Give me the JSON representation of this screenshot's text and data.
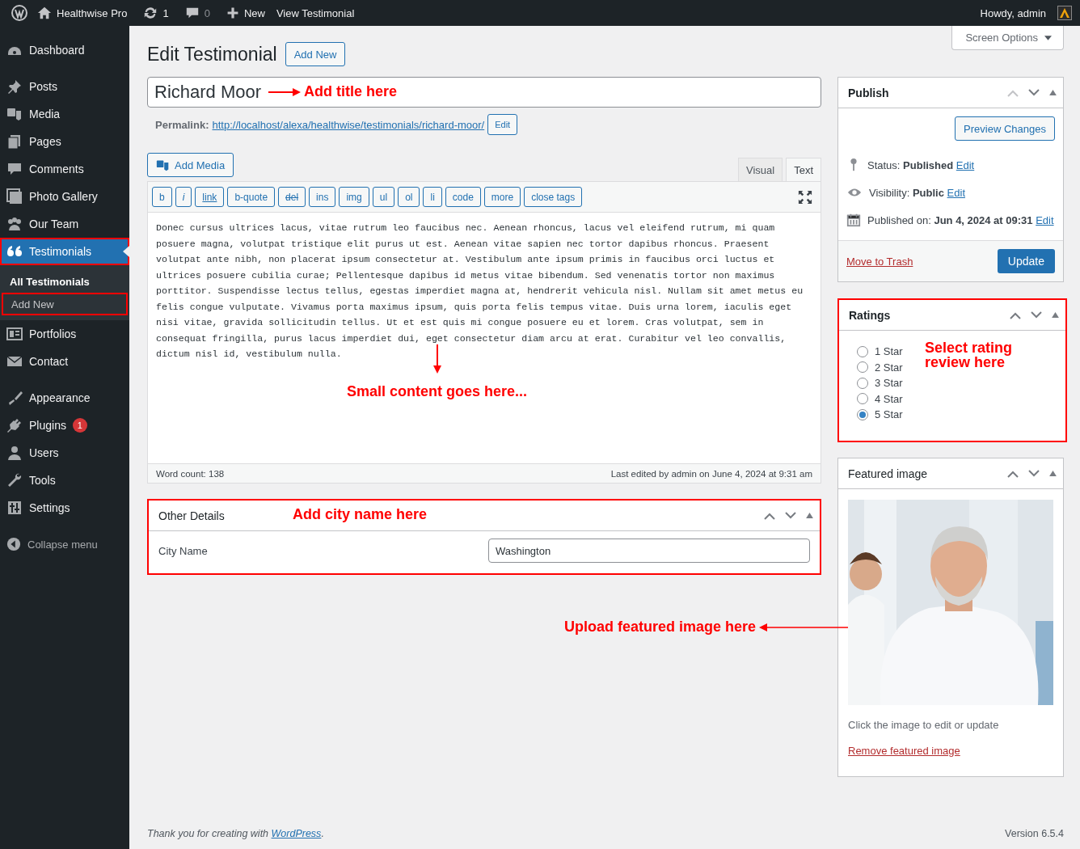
{
  "admin_bar": {
    "site_name": "Healthwise Pro",
    "updates": "1",
    "comments": "0",
    "new_label": "New",
    "view_label": "View Testimonial",
    "greeting": "Howdy, admin"
  },
  "sidebar": {
    "groups": [
      [
        {
          "label": "Dashboard",
          "selected": false,
          "highlighted": false
        }
      ],
      [
        {
          "label": "Posts",
          "selected": false,
          "highlighted": false
        },
        {
          "label": "Media",
          "selected": false,
          "highlighted": false
        },
        {
          "label": "Pages",
          "selected": false,
          "highlighted": false
        },
        {
          "label": "Comments",
          "selected": false,
          "highlighted": false
        },
        {
          "label": "Photo Gallery",
          "selected": false,
          "highlighted": false
        },
        {
          "label": "Our Team",
          "selected": false,
          "highlighted": false
        },
        {
          "label": "Testimonials",
          "selected": true,
          "highlighted": true,
          "children": [
            {
              "label": "All Testimonials",
              "selected": true,
              "highlighted": false
            },
            {
              "label": "Add New",
              "selected": false,
              "highlighted": true
            }
          ]
        },
        {
          "label": "Portfolios",
          "selected": false,
          "highlighted": false
        },
        {
          "label": "Contact",
          "selected": false,
          "highlighted": false
        }
      ],
      [
        {
          "label": "Appearance",
          "selected": false,
          "highlighted": false
        },
        {
          "label": "Plugins",
          "selected": false,
          "highlighted": false,
          "badge": "1"
        },
        {
          "label": "Users",
          "selected": false,
          "highlighted": false
        },
        {
          "label": "Tools",
          "selected": false,
          "highlighted": false
        },
        {
          "label": "Settings",
          "selected": false,
          "highlighted": false
        }
      ]
    ],
    "collapse_label": "Collapse menu"
  },
  "screen_options": "Screen Options",
  "heading": "Edit Testimonial",
  "add_new_button": "Add New",
  "title": {
    "value": "Richard Moor",
    "annotation": "Add title here"
  },
  "permalink": {
    "label": "Permalink:",
    "url": "http://localhost/alexa/healthwise/testimonials/richard-moor/",
    "button": "Edit"
  },
  "add_media_button": "Add Media",
  "editor_tabs": [
    {
      "label": "Visual",
      "selected": false
    },
    {
      "label": "Text",
      "selected": true
    }
  ],
  "toolbar": [
    {
      "label": "b",
      "kind": "plain"
    },
    {
      "label": "i",
      "kind": "italic"
    },
    {
      "label": "link",
      "kind": "underline"
    },
    {
      "label": "b-quote",
      "kind": "plain"
    },
    {
      "label": "del",
      "kind": "strike"
    },
    {
      "label": "ins",
      "kind": "plain"
    },
    {
      "label": "img",
      "kind": "plain"
    },
    {
      "label": "ul",
      "kind": "plain"
    },
    {
      "label": "ol",
      "kind": "plain"
    },
    {
      "label": "li",
      "kind": "plain"
    },
    {
      "label": "code",
      "kind": "plain"
    },
    {
      "label": "more",
      "kind": "plain"
    },
    {
      "label": "close tags",
      "kind": "plain"
    }
  ],
  "content": "Donec cursus ultrices lacus, vitae rutrum leo faucibus nec. Aenean rhoncus, lacus vel eleifend rutrum, mi quam posuere magna, volutpat tristique elit purus ut est. Aenean vitae sapien nec tortor dapibus rhoncus. Praesent volutpat ante nibh, non placerat ipsum consectetur at. Vestibulum ante ipsum primis in faucibus orci luctus et ultrices posuere cubilia curae; Pellentesque dapibus id metus vitae bibendum. Sed venenatis tortor non maximus porttitor. Suspendisse lectus tellus, egestas imperdiet magna at, hendrerit vehicula nisl. Nullam sit amet metus eu felis congue vulputate. Vivamus porta maximus ipsum, quis porta felis tempus vitae. Duis urna lorem, iaculis eget nisi vitae, gravida sollicitudin tellus. Ut et est quis mi congue posuere eu et lorem. Cras volutpat, sem in consequat fringilla, purus lacus imperdiet dui, eget consectetur diam arcu at erat. Curabitur vel leo convallis, dictum nisl id, vestibulum nulla.",
  "content_annotation": "Small content goes here...",
  "word_count": "Word count: 138",
  "last_edited": "Last edited by admin on June 4, 2024 at 9:31 am",
  "other_details": {
    "title": "Other Details",
    "highlighted": true,
    "annotation": "Add city name here",
    "field_label": "City Name",
    "field_value": "Washington"
  },
  "publish": {
    "title": "Publish",
    "preview_button": "Preview Changes",
    "rows": [
      {
        "label": "Status:",
        "value": "Published",
        "link": "Edit"
      },
      {
        "label": "Visibility:",
        "value": "Public",
        "link": "Edit"
      },
      {
        "label": "Published on:",
        "value": "Jun 4, 2024 at 09:31",
        "link": "Edit"
      }
    ],
    "trash_link": "Move to Trash",
    "update_button": "Update"
  },
  "ratings": {
    "title": "Ratings",
    "highlighted": true,
    "annotation": "Select rating review here",
    "options": [
      {
        "label": "1 Star",
        "selected": false
      },
      {
        "label": "2 Star",
        "selected": false
      },
      {
        "label": "3 Star",
        "selected": false
      },
      {
        "label": "4 Star",
        "selected": false
      },
      {
        "label": "5 Star",
        "selected": true
      }
    ]
  },
  "featured_image": {
    "title": "Featured image",
    "caption": "Click the image to edit or update",
    "remove_link": "Remove featured image",
    "annotation": "Upload featured image here"
  },
  "footer": {
    "text": "Thank you for creating with ",
    "link": "WordPress",
    "text_after": ".",
    "version": "Version 6.5.4"
  }
}
